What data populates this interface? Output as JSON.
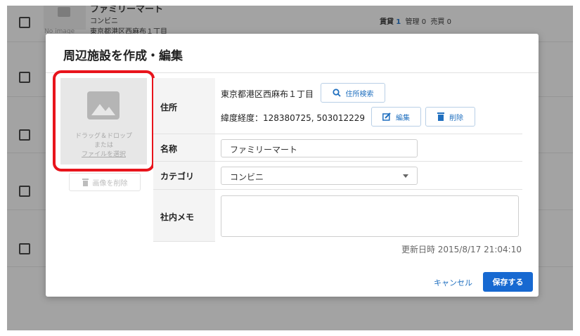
{
  "background_list": {
    "rows": [
      {
        "thumbnail_text": "No image",
        "name": "ファミリーマート",
        "category": "コンビニ",
        "address": "東京都港区西麻布１丁目",
        "stats": {
          "rent_label": "賃貸",
          "rent_value": "1",
          "manage_label": "管理",
          "manage_value": "0",
          "sale_label": "売買",
          "sale_value": "0"
        }
      }
    ]
  },
  "modal": {
    "title": "周辺施設を作成・編集",
    "image": {
      "drop_text": "ドラッグ＆ドロップ",
      "or_text": "または",
      "select_file_link": "ファイルを選択",
      "delete_label": "画像を削除"
    },
    "form": {
      "address": {
        "label": "住所",
        "value": "東京都港区西麻布１丁目",
        "search_button": "住所検索",
        "latlng": "緯度経度：128380725, 503012229",
        "edit_button": "編集",
        "delete_button": "削除"
      },
      "name": {
        "label": "名称",
        "value": "ファミリーマート"
      },
      "category": {
        "label": "カテゴリ",
        "value": "コンビニ"
      },
      "memo": {
        "label": "社内メモ",
        "value": ""
      }
    },
    "updated_at": "更新日時 2015/8/17 21:04:10",
    "cancel_label": "キャンセル",
    "save_label": "保存する"
  },
  "colors": {
    "accent": "#1769d1",
    "link": "#1f6fbf",
    "highlight": "#e8141c",
    "overlay": "#a3a3a3"
  }
}
